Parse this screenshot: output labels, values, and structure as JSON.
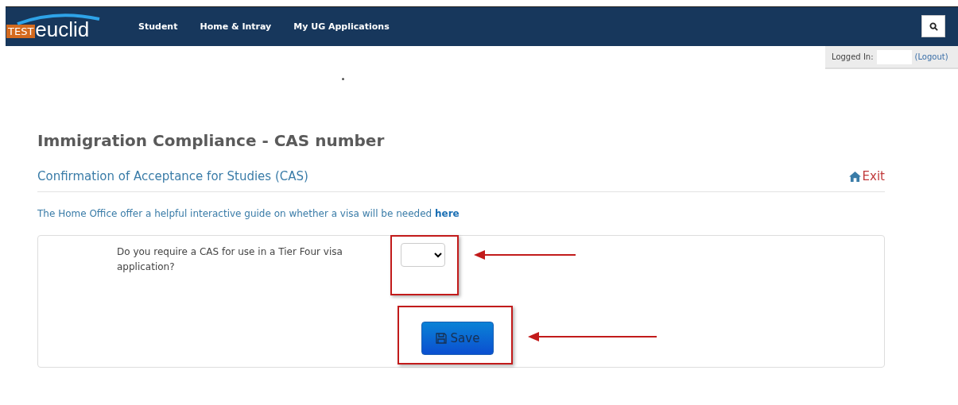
{
  "header": {
    "logo": {
      "badge": "TEST",
      "name": "euclid"
    },
    "nav": [
      {
        "label": "Student"
      },
      {
        "label": "Home & Intray"
      },
      {
        "label": "My UG Applications"
      }
    ]
  },
  "login": {
    "label": "Logged In:",
    "logout": "(Logout)"
  },
  "page": {
    "title": "Immigration Compliance - CAS number",
    "subtitle": "Confirmation of Acceptance for Studies (CAS)",
    "exit": "Exit",
    "guide": {
      "text": "The Home Office offer a helpful interactive guide on whether a visa will be needed",
      "link": "here"
    }
  },
  "form": {
    "question": "Do you require a CAS for use in a Tier Four visa application?",
    "save": "Save"
  }
}
